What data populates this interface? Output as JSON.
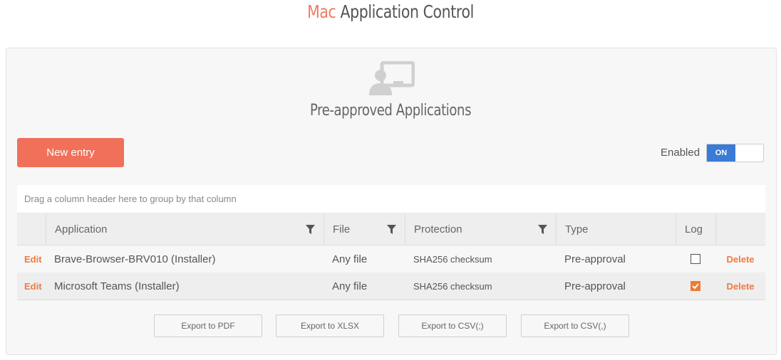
{
  "header": {
    "title_accent": "Mac",
    "title_rest": "Application Control"
  },
  "section": {
    "title": "Pre-approved Applications",
    "icon": "user-screen-icon"
  },
  "toolbar": {
    "new_entry_label": "New entry",
    "enabled_label": "Enabled",
    "toggle_state": "ON"
  },
  "grid": {
    "group_hint": "Drag a column header here to group by that column",
    "columns": [
      "Application",
      "File",
      "Protection",
      "Type",
      "Log"
    ],
    "rows": [
      {
        "edit": "Edit",
        "application": "Brave-Browser-BRV010 (Installer)",
        "file": "Any file",
        "protection": "SHA256 checksum",
        "type": "Pre-approval",
        "log": false,
        "delete": "Delete"
      },
      {
        "edit": "Edit",
        "application": "Microsoft Teams (Installer)",
        "file": "Any file",
        "protection": "SHA256 checksum",
        "type": "Pre-approval",
        "log": true,
        "delete": "Delete"
      }
    ]
  },
  "export": {
    "pdf": "Export to PDF",
    "xlsx": "Export to XLSX",
    "csv_semicolon": "Export to CSV(;)",
    "csv_comma": "Export to CSV(,)"
  },
  "colors": {
    "accent": "#ef7a66",
    "button": "#f0705a",
    "toggle_on": "#3a7bd5",
    "link": "#ef7a40",
    "checkbox": "#f07a32"
  }
}
